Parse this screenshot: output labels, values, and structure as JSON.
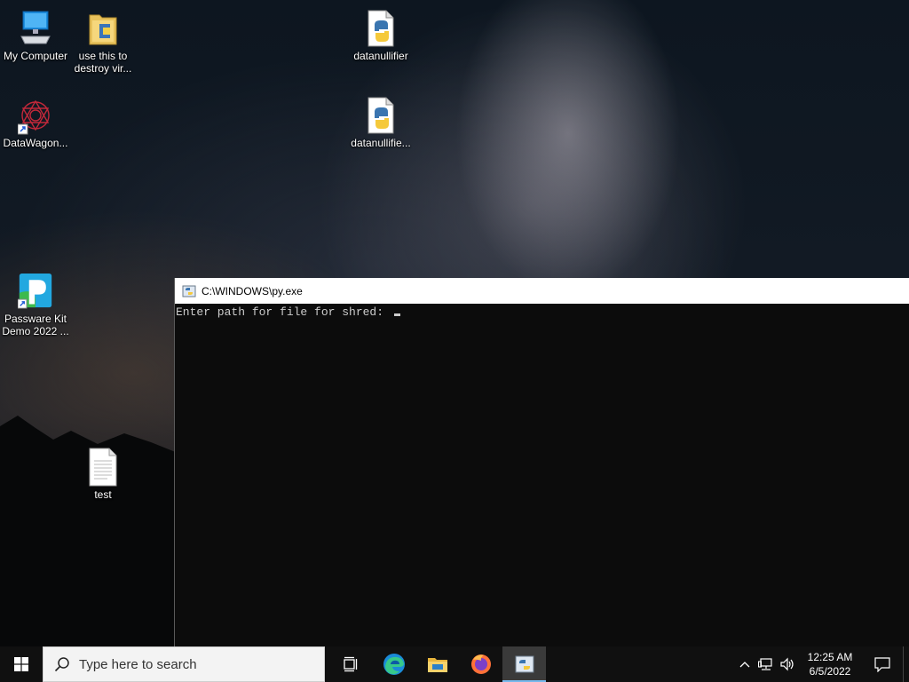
{
  "desktop": {
    "icons": [
      {
        "id": "my-computer",
        "label": "My Computer",
        "icon": "computer-icon"
      },
      {
        "id": "use-this",
        "label": "use this to\ndestroy vir...",
        "icon": "folder-icon"
      },
      {
        "id": "datanullifier-1",
        "label": "datanullifier",
        "icon": "python-file-icon"
      },
      {
        "id": "datawagon",
        "label": "DataWagon...",
        "icon": "datawagon-icon"
      },
      {
        "id": "datanullifier-2",
        "label": "datanullifie...",
        "icon": "python-file-icon"
      },
      {
        "id": "passware",
        "label": "Passware Kit\nDemo 2022 ...",
        "icon": "passware-icon"
      },
      {
        "id": "test",
        "label": "test",
        "icon": "text-file-icon"
      }
    ]
  },
  "console": {
    "title": "C:\\WINDOWS\\py.exe",
    "prompt": "Enter path for file for shred: "
  },
  "taskbar": {
    "search_placeholder": "Type here to search",
    "pinned": [
      "task-view-icon",
      "edge-icon",
      "file-explorer-icon",
      "firefox-icon",
      "python-launcher-icon"
    ],
    "active": "python-launcher-icon",
    "clock_time": "12:25 AM",
    "clock_date": "6/5/2022"
  },
  "colors": {
    "taskbar_bg": "#101010",
    "console_bg": "#0c0c0c",
    "console_text": "#cccccc",
    "active_indicator": "#76b9ed"
  }
}
